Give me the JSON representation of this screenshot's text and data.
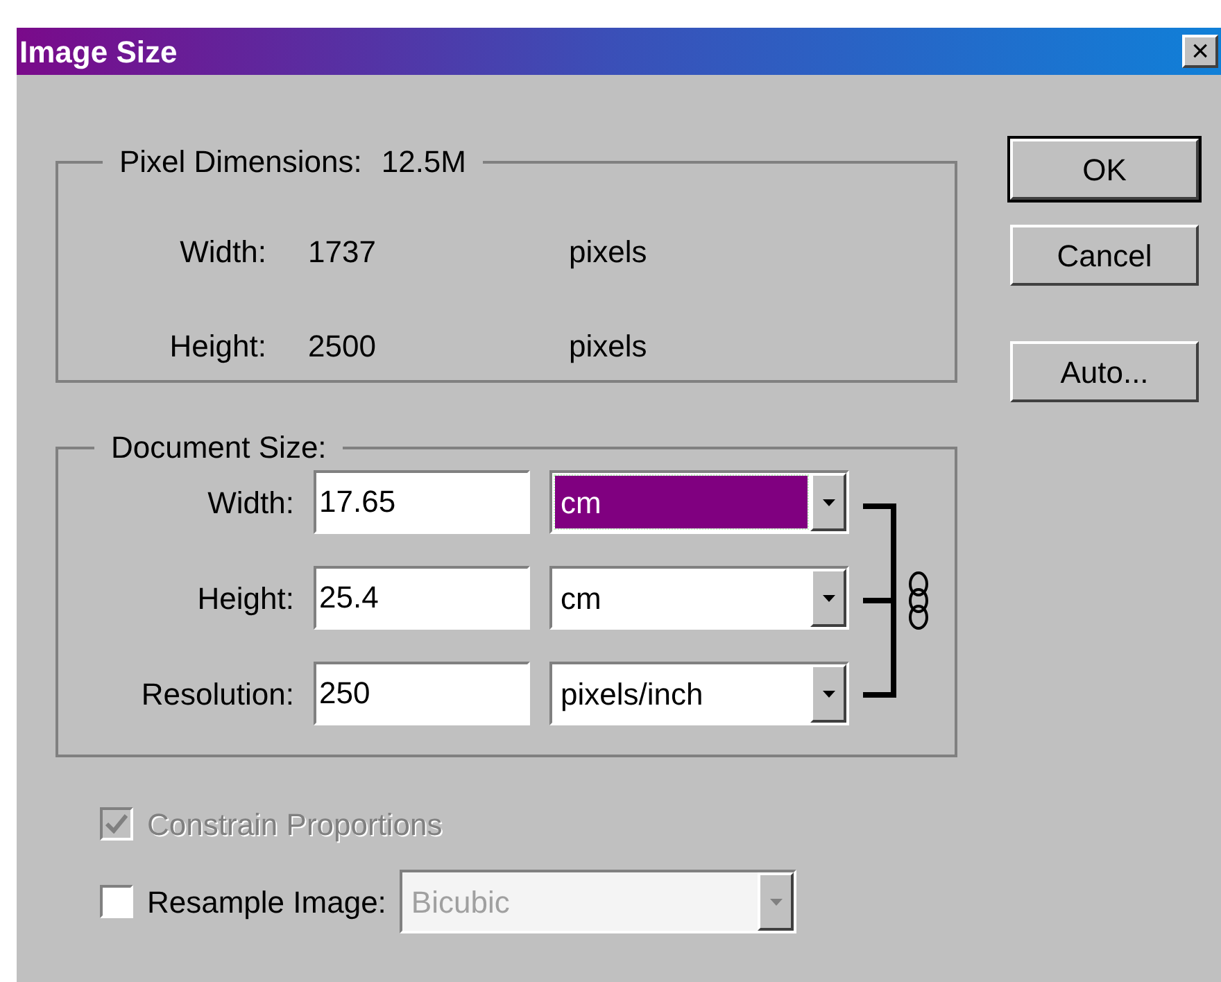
{
  "window": {
    "title": "Image Size",
    "close": "×"
  },
  "pixel_dimensions": {
    "legend": "Pixel Dimensions:",
    "size": "12.5M",
    "rows": [
      {
        "label": "Width:",
        "value": "1737",
        "unit": "pixels"
      },
      {
        "label": "Height:",
        "value": "2500",
        "unit": "pixels"
      }
    ]
  },
  "document_size": {
    "legend": "Document Size:",
    "rows": [
      {
        "label": "Width:",
        "value": "17.65",
        "unit": "cm",
        "focused": true
      },
      {
        "label": "Height:",
        "value": "25.4",
        "unit": "cm",
        "focused": false
      },
      {
        "label": "Resolution:",
        "value": "250",
        "unit": "pixels/inch",
        "focused": false
      }
    ],
    "linked": true
  },
  "options": [
    {
      "kind": "checkbox",
      "label": "Constrain Proportions",
      "checked": true,
      "disabled": true
    },
    {
      "kind": "checkbox-select",
      "label": "Resample Image:",
      "checked": false,
      "disabled": false,
      "select": {
        "value": "Bicubic",
        "disabled": true
      }
    }
  ],
  "buttons": [
    {
      "label": "OK",
      "default": true
    },
    {
      "label": "Cancel",
      "default": false
    },
    {
      "label": "Auto...",
      "default": false
    }
  ]
}
